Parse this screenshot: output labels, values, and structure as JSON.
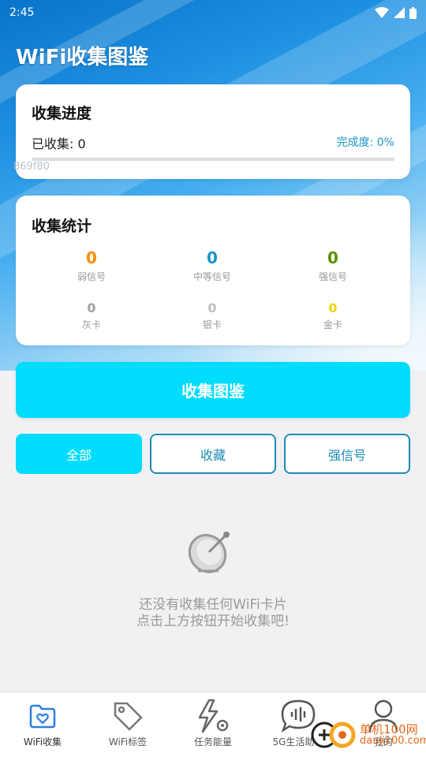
{
  "status_bar": {
    "time": "2:45"
  },
  "app": {
    "title": "WiFi收集图鉴"
  },
  "progress_card": {
    "title": "收集进度",
    "collected_text": "已收集: 0",
    "completion_text": "完成度: 0%",
    "progress_fraction": 0,
    "debug_text": "869f80"
  },
  "stats_card": {
    "title": "收集统计",
    "stats": [
      {
        "value": "0",
        "label": "弱信号",
        "color": "#ff8c00"
      },
      {
        "value": "0",
        "label": "中等信号",
        "color": "#1a95c7"
      },
      {
        "value": "0",
        "label": "强信号",
        "color": "#5c8f00"
      },
      {
        "value": "0",
        "label": "灰卡",
        "color": "#a0a0a0"
      },
      {
        "value": "0",
        "label": "银卡",
        "color": "#c0c0c0"
      },
      {
        "value": "0",
        "label": "金卡",
        "color": "#f3d400"
      }
    ]
  },
  "main_button": {
    "label": "收集图鉴"
  },
  "filters": [
    {
      "label": "全部",
      "active": true
    },
    {
      "label": "收藏",
      "active": false
    },
    {
      "label": "强信号",
      "active": false
    }
  ],
  "empty_state": {
    "icon": "satellite-dish-icon",
    "line1": "还没有收集任何WiFi卡片",
    "line2": "点击上方按钮开始收集吧!"
  },
  "tabs": [
    {
      "label": "WiFi收集",
      "icon": "heart-folder-icon",
      "active": true
    },
    {
      "label": "WiFi标签",
      "icon": "tag-icon",
      "active": false
    },
    {
      "label": "任务能量",
      "icon": "energy-gear-icon",
      "active": false
    },
    {
      "label": "5G生活助手",
      "icon": "voice-chat-icon",
      "active": false
    },
    {
      "label": "我的",
      "icon": "user-icon",
      "active": false
    }
  ],
  "watermark": {
    "line1": "单机100网",
    "line2": "danji100.com"
  },
  "colors": {
    "accent": "#00dcfb",
    "link": "#1a95c7",
    "outline": "#1b8cb5"
  }
}
